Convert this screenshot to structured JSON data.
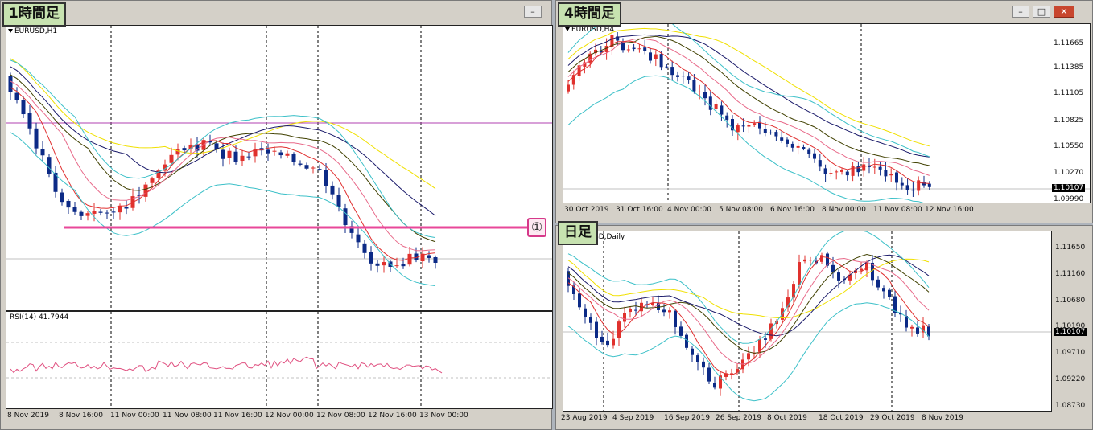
{
  "windows": {
    "h1": {
      "title": "1時間足",
      "symbol": "EURUSD,H1",
      "rsi_label": "RSI(14) 41.7944",
      "time_labels": [
        "8 Nov 2019",
        "8 Nov 16:00",
        "11 Nov 00:00",
        "11 Nov 08:00",
        "11 Nov 16:00",
        "12 Nov 00:00",
        "12 Nov 08:00",
        "12 Nov 16:00",
        "13 Nov 00:00"
      ],
      "annotation": "①"
    },
    "h4": {
      "title": "4時間足",
      "symbol": "EURUSD,H4",
      "price_labels": [
        "1.11665",
        "1.11385",
        "1.11105",
        "1.10825",
        "1.10550",
        "1.10270",
        "1.09990"
      ],
      "current_price": "1.10107",
      "time_labels": [
        "30 Oct 2019",
        "31 Oct 16:00",
        "4 Nov 00:00",
        "5 Nov 08:00",
        "6 Nov 16:00",
        "8 Nov 00:00",
        "11 Nov 08:00",
        "12 Nov 16:00"
      ]
    },
    "d1": {
      "title": "日足",
      "symbol": "SD,Daily",
      "price_labels": [
        "1.11650",
        "1.11160",
        "1.10680",
        "1.10190",
        "1.09710",
        "1.09220",
        "1.08730"
      ],
      "current_price": "1.10107",
      "time_labels": [
        "23 Aug 2019",
        "4 Sep 2019",
        "16 Sep 2019",
        "26 Sep 2019",
        "8 Oct 2019",
        "18 Oct 2019",
        "29 Oct 2019",
        "8 Nov 2019"
      ]
    }
  },
  "colors": {
    "bull": "#e0312d",
    "bear": "#0c2a86",
    "ma_yellow": "#f0e000",
    "ma_navy": "#1a1a6a",
    "ma_olive": "#404000",
    "ma_pink": "#e86a8a",
    "ma_red": "#e03030",
    "bollinger": "#3cc0c8",
    "level_line": "#e8489a",
    "hline": "#b040b0",
    "rsi": "#e05080"
  },
  "icons": [
    "minimize-icon",
    "maximize-icon",
    "close-icon"
  ]
}
